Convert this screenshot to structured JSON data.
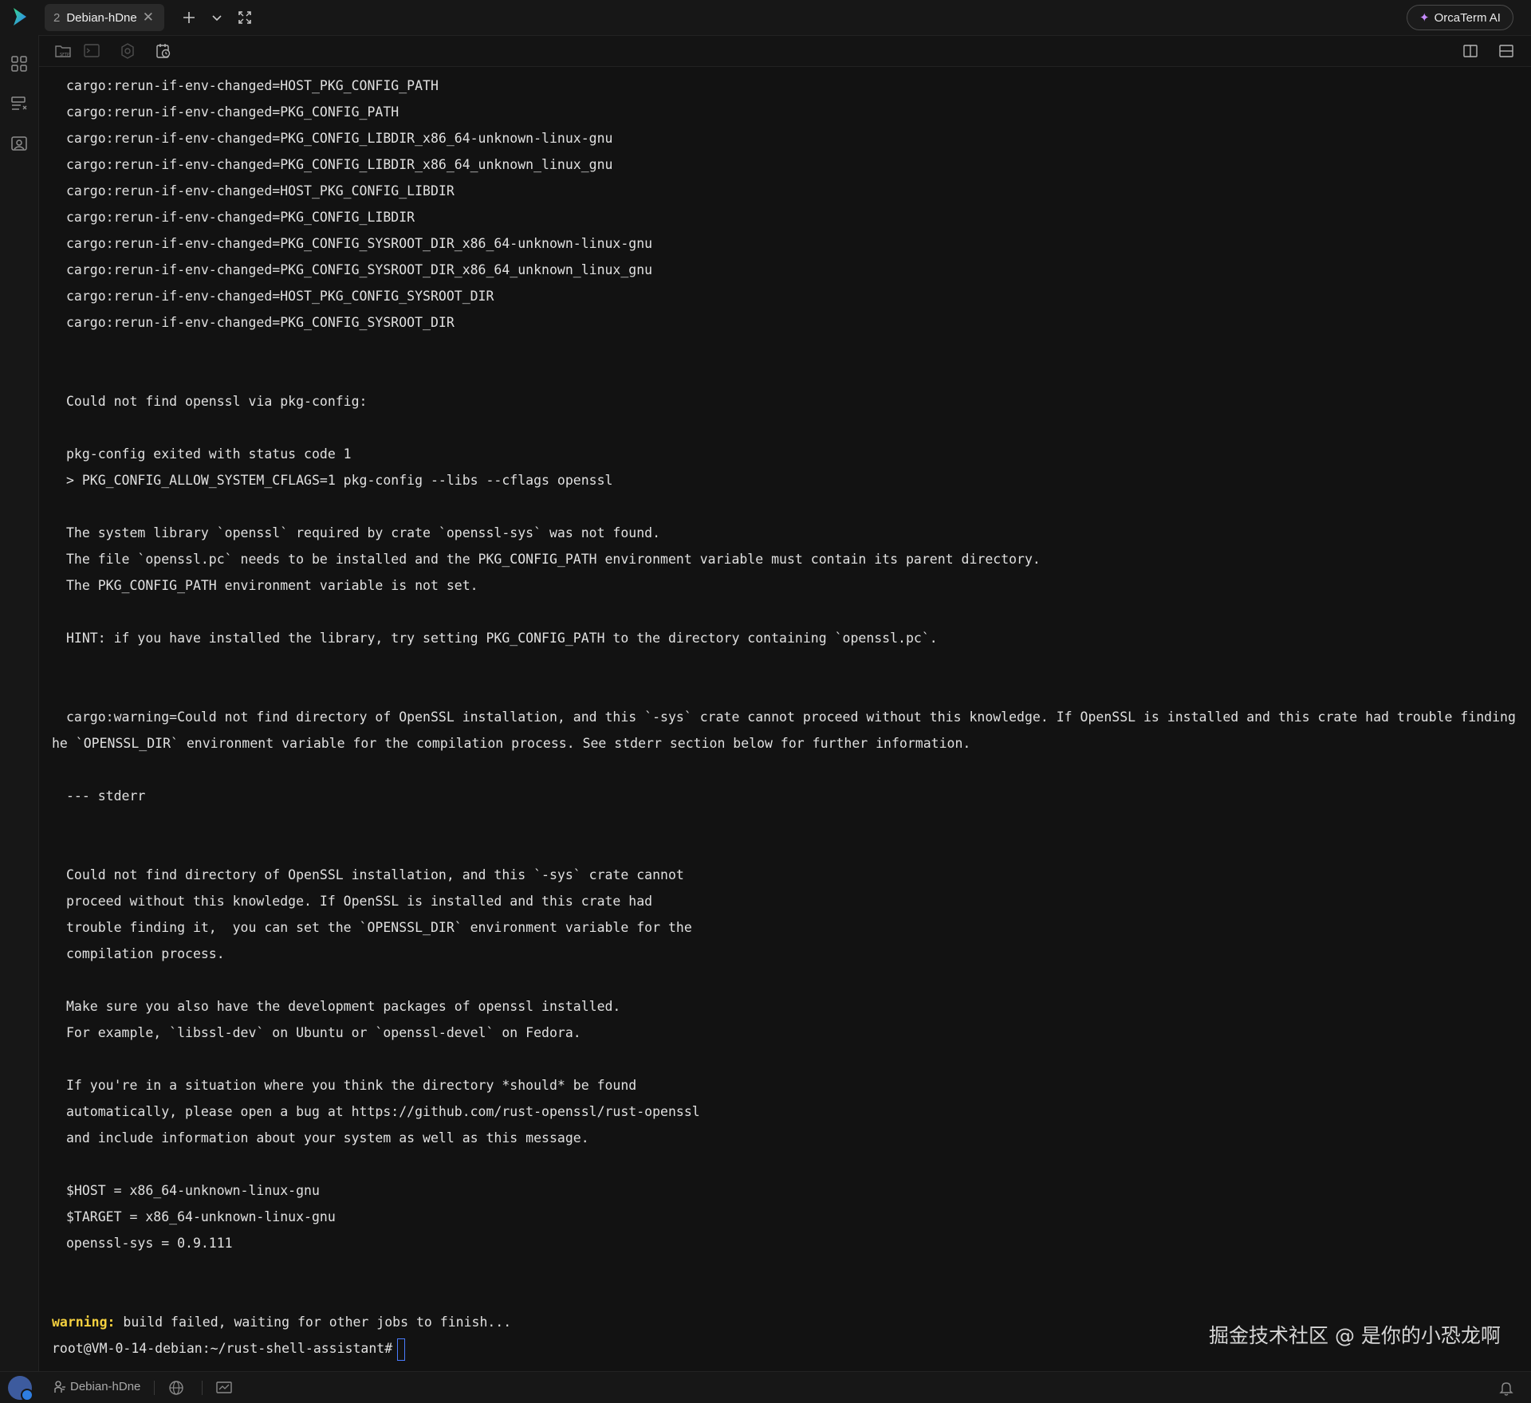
{
  "window": {
    "tab": {
      "index": "2",
      "title": "Debian-hDne"
    },
    "ai_button_label": "OrcaTerm AI"
  },
  "icons": {
    "logo": "app-logo",
    "tab_close": "close-icon",
    "new_tab": "plus-icon",
    "tab_menu": "chevron-down-icon",
    "fullscreen": "fullscreen-icon",
    "ai_spark": "sparkle-icon",
    "sidebar": [
      "grid-icon",
      "server-list-icon",
      "profile-icon"
    ],
    "toolbar": [
      "sftp-icon",
      "terminal-icon",
      "settings-icon",
      "history-icon"
    ],
    "split_vertical": "split-vertical-icon",
    "split_horizontal": "split-horizontal-icon",
    "status": [
      "globe-icon",
      "monitor-icon",
      "bell-icon"
    ]
  },
  "terminal": {
    "lines": [
      {
        "indent": true,
        "text": "cargo:rerun-if-env-changed=HOST_PKG_CONFIG_PATH"
      },
      {
        "indent": true,
        "text": "cargo:rerun-if-env-changed=PKG_CONFIG_PATH"
      },
      {
        "indent": true,
        "text": "cargo:rerun-if-env-changed=PKG_CONFIG_LIBDIR_x86_64-unknown-linux-gnu"
      },
      {
        "indent": true,
        "text": "cargo:rerun-if-env-changed=PKG_CONFIG_LIBDIR_x86_64_unknown_linux_gnu"
      },
      {
        "indent": true,
        "text": "cargo:rerun-if-env-changed=HOST_PKG_CONFIG_LIBDIR"
      },
      {
        "indent": true,
        "text": "cargo:rerun-if-env-changed=PKG_CONFIG_LIBDIR"
      },
      {
        "indent": true,
        "text": "cargo:rerun-if-env-changed=PKG_CONFIG_SYSROOT_DIR_x86_64-unknown-linux-gnu"
      },
      {
        "indent": true,
        "text": "cargo:rerun-if-env-changed=PKG_CONFIG_SYSROOT_DIR_x86_64_unknown_linux_gnu"
      },
      {
        "indent": true,
        "text": "cargo:rerun-if-env-changed=HOST_PKG_CONFIG_SYSROOT_DIR"
      },
      {
        "indent": true,
        "text": "cargo:rerun-if-env-changed=PKG_CONFIG_SYSROOT_DIR"
      },
      {
        "indent": true,
        "text": ""
      },
      {
        "indent": true,
        "text": ""
      },
      {
        "indent": true,
        "text": "Could not find openssl via pkg-config:"
      },
      {
        "indent": true,
        "text": ""
      },
      {
        "indent": true,
        "text": "pkg-config exited with status code 1"
      },
      {
        "indent": true,
        "text": "> PKG_CONFIG_ALLOW_SYSTEM_CFLAGS=1 pkg-config --libs --cflags openssl"
      },
      {
        "indent": true,
        "text": ""
      },
      {
        "indent": true,
        "text": "The system library `openssl` required by crate `openssl-sys` was not found."
      },
      {
        "indent": true,
        "text": "The file `openssl.pc` needs to be installed and the PKG_CONFIG_PATH environment variable must contain its parent directory."
      },
      {
        "indent": true,
        "text": "The PKG_CONFIG_PATH environment variable is not set."
      },
      {
        "indent": true,
        "text": ""
      },
      {
        "indent": true,
        "text": "HINT: if you have installed the library, try setting PKG_CONFIG_PATH to the directory containing `openssl.pc`."
      },
      {
        "indent": true,
        "text": ""
      },
      {
        "indent": true,
        "text": ""
      },
      {
        "indent": true,
        "text": "cargo:warning=Could not find directory of OpenSSL installation, and this `-sys` crate cannot proceed without this knowledge. If OpenSSL is installed and this crate had trouble finding it,  you can set t"
      },
      {
        "indent": false,
        "text": "he `OPENSSL_DIR` environment variable for the compilation process. See stderr section below for further information."
      },
      {
        "indent": true,
        "text": ""
      },
      {
        "indent": true,
        "text": "--- stderr"
      },
      {
        "indent": true,
        "text": ""
      },
      {
        "indent": true,
        "text": ""
      },
      {
        "indent": true,
        "text": "Could not find directory of OpenSSL installation, and this `-sys` crate cannot"
      },
      {
        "indent": true,
        "text": "proceed without this knowledge. If OpenSSL is installed and this crate had"
      },
      {
        "indent": true,
        "text": "trouble finding it,  you can set the `OPENSSL_DIR` environment variable for the"
      },
      {
        "indent": true,
        "text": "compilation process."
      },
      {
        "indent": true,
        "text": ""
      },
      {
        "indent": true,
        "text": "Make sure you also have the development packages of openssl installed."
      },
      {
        "indent": true,
        "text": "For example, `libssl-dev` on Ubuntu or `openssl-devel` on Fedora."
      },
      {
        "indent": true,
        "text": ""
      },
      {
        "indent": true,
        "text": "If you're in a situation where you think the directory *should* be found"
      },
      {
        "indent": true,
        "text": "automatically, please open a bug at https://github.com/rust-openssl/rust-openssl"
      },
      {
        "indent": true,
        "text": "and include information about your system as well as this message."
      },
      {
        "indent": true,
        "text": ""
      },
      {
        "indent": true,
        "text": "$HOST = x86_64-unknown-linux-gnu"
      },
      {
        "indent": true,
        "text": "$TARGET = x86_64-unknown-linux-gnu"
      },
      {
        "indent": true,
        "text": "openssl-sys = 0.9.111"
      },
      {
        "indent": true,
        "text": ""
      },
      {
        "indent": true,
        "text": ""
      }
    ],
    "warning_keyword": "warning:",
    "warning_text": " build failed, waiting for other jobs to finish...",
    "prompt": "root@VM-0-14-debian:~/rust-shell-assistant#"
  },
  "watermark": "掘金技术社区 @ 是你的小恐龙啊",
  "statusbar": {
    "host_label": "Debian-hDne"
  },
  "colors": {
    "background": "#121212",
    "text": "#e0e0e0",
    "warning": "#f4d03f",
    "cursor": "#4a7cff",
    "ai_accent": "#c78bff"
  }
}
